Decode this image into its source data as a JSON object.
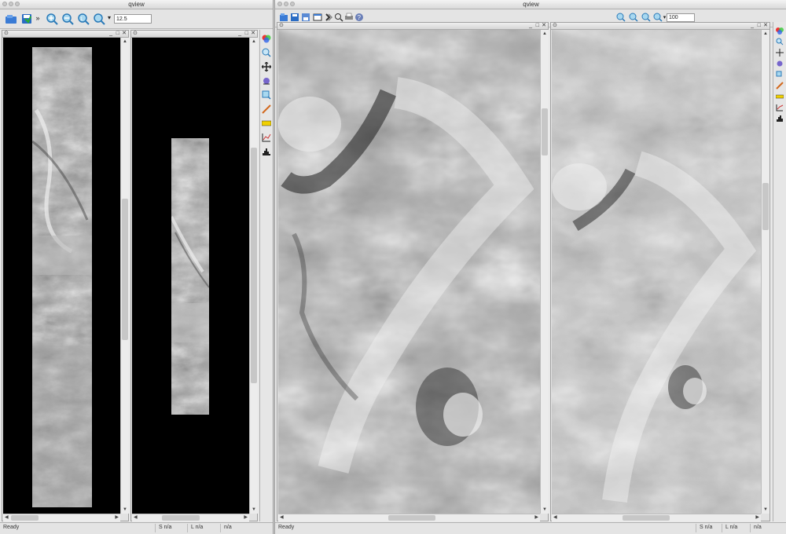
{
  "windows": {
    "left": {
      "title": "qview",
      "zoom_value": "12.5",
      "status": {
        "ready": "Ready",
        "sample": "S n/a",
        "line": "L n/a",
        "value": "n/a"
      }
    },
    "right": {
      "title": "qview",
      "zoom_value": "100",
      "status": {
        "ready": "Ready",
        "sample": "S n/a",
        "line": "L n/a",
        "value": "n/a"
      }
    }
  },
  "toolbar": {
    "overflow_glyph": "»",
    "dropdown_glyph": "▾"
  },
  "icons": [
    "open-icon",
    "save-icon",
    "zoom-in-icon",
    "zoom-out-icon",
    "zoom-fit-icon",
    "zoom-menu-icon",
    "color-icon",
    "magnify-icon",
    "pan-icon",
    "stretch-icon",
    "find-icon",
    "measure-icon",
    "spectral-icon",
    "plot-icon",
    "histogram-icon"
  ],
  "subwindow_controls": {
    "minimize": "_",
    "maximize": "□",
    "close": "✕"
  },
  "colors": {
    "window_bg": "#e8e8e8",
    "viewport_bg": "#000000",
    "image_gray": "#a8a8a8"
  }
}
